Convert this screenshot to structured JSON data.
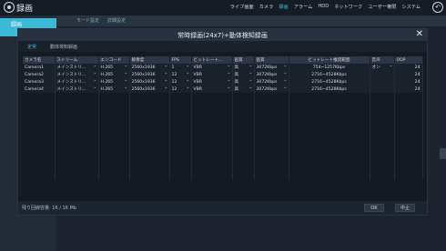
{
  "app": {
    "title": "録画"
  },
  "menu": {
    "items": [
      "ライブ画面",
      "カメラ",
      "録画",
      "アラーム",
      "HDD",
      "ネットワーク",
      "ユーザー権限",
      "システム"
    ],
    "active_index": 2
  },
  "sidebar": {
    "selected": "録画"
  },
  "subtabs": [
    "モード設定",
    "詳細設定"
  ],
  "modal": {
    "title": "常時録画(24x7)+動体検知録画",
    "tabs": [
      "定常",
      "動体検知録画"
    ],
    "columns": [
      "カメラ名",
      "ストリーム",
      "エンコード",
      "解像度",
      "FPS",
      "ビットレート...",
      "画質",
      "画質",
      "ビットレート推奨範囲",
      "音声",
      "OOP"
    ],
    "rows": [
      [
        "Camera1",
        "メインストリ...",
        "H.265",
        "2560x1936",
        "1",
        "VBR",
        "高",
        "3072Kbps",
        "754~1257Kbps",
        "オン",
        "24"
      ],
      [
        "Camera2",
        "メインストリ...",
        "H.265",
        "2560x1936",
        "12",
        "VBR",
        "高",
        "3072Kbps",
        "2716~4528Kbps",
        "",
        "24"
      ],
      [
        "Camera3",
        "メインストリ...",
        "H.265",
        "2560x1936",
        "12",
        "VBR",
        "高",
        "3072Kbps",
        "2716~4528Kbps",
        "",
        "24"
      ],
      [
        "Camera4",
        "メインストリ...",
        "H.265",
        "2560x1936",
        "12",
        "VBR",
        "高",
        "3072Kbps",
        "2716~4528Kbps",
        "",
        "24"
      ]
    ],
    "storage": "残り回線容量: 16 / 16 Mb",
    "ok_label": "OK",
    "cancel_label": "中止"
  },
  "colors": {
    "accent": "#3db9d8",
    "background": "#141a22",
    "header": "#273140"
  }
}
